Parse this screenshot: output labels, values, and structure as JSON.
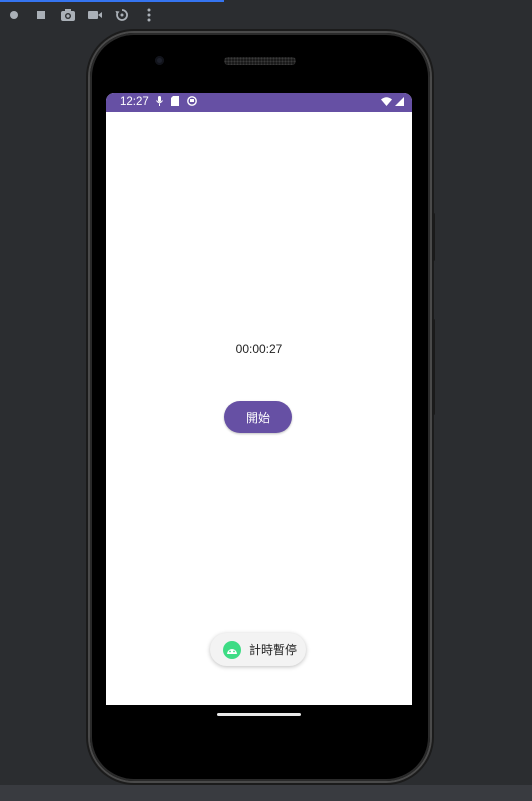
{
  "emulator_toolbar": {
    "icons": [
      "power-icon",
      "stop-icon",
      "camera-icon",
      "video-icon",
      "rotate-icon",
      "more-icon"
    ]
  },
  "status_bar": {
    "time": "12:27",
    "color": "#6650a4"
  },
  "app": {
    "timer_text": "00:00:27",
    "start_button_label": "開始",
    "accent_color": "#6650a4"
  },
  "toast": {
    "text": "計時暫停",
    "icon": "android-icon"
  }
}
